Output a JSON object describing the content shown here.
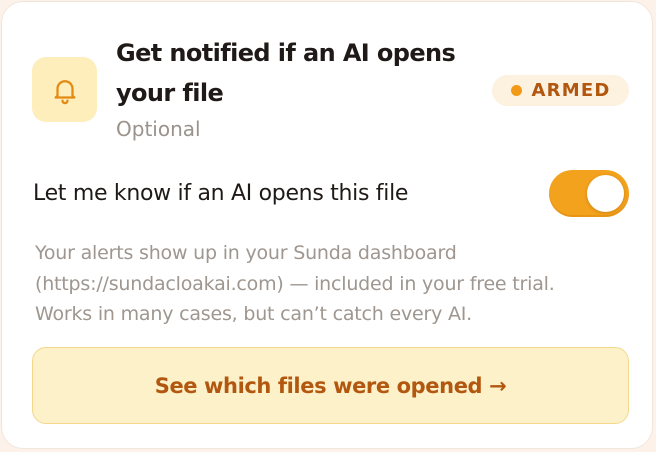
{
  "header": {
    "icon": "bell-icon",
    "title": "Get notified if an AI opens your file",
    "subtitle": "Optional",
    "badge": {
      "label": "ARMED",
      "dot_color": "#f29a18"
    }
  },
  "toggle": {
    "label": "Let me know if an AI opens this file",
    "enabled": true,
    "color": "#f3a21d"
  },
  "note": {
    "lines": [
      "Your alerts show up in your Sunda dashboard",
      "(https://sundacloakai.com) — included in your free trial.",
      "Works in many cases, but can’t catch every AI."
    ]
  },
  "cta": {
    "label": "See which files were opened →"
  },
  "colors": {
    "accent": "#f3a21d",
    "accent_text": "#b1570f",
    "cta_background": "#fdf1c9"
  }
}
